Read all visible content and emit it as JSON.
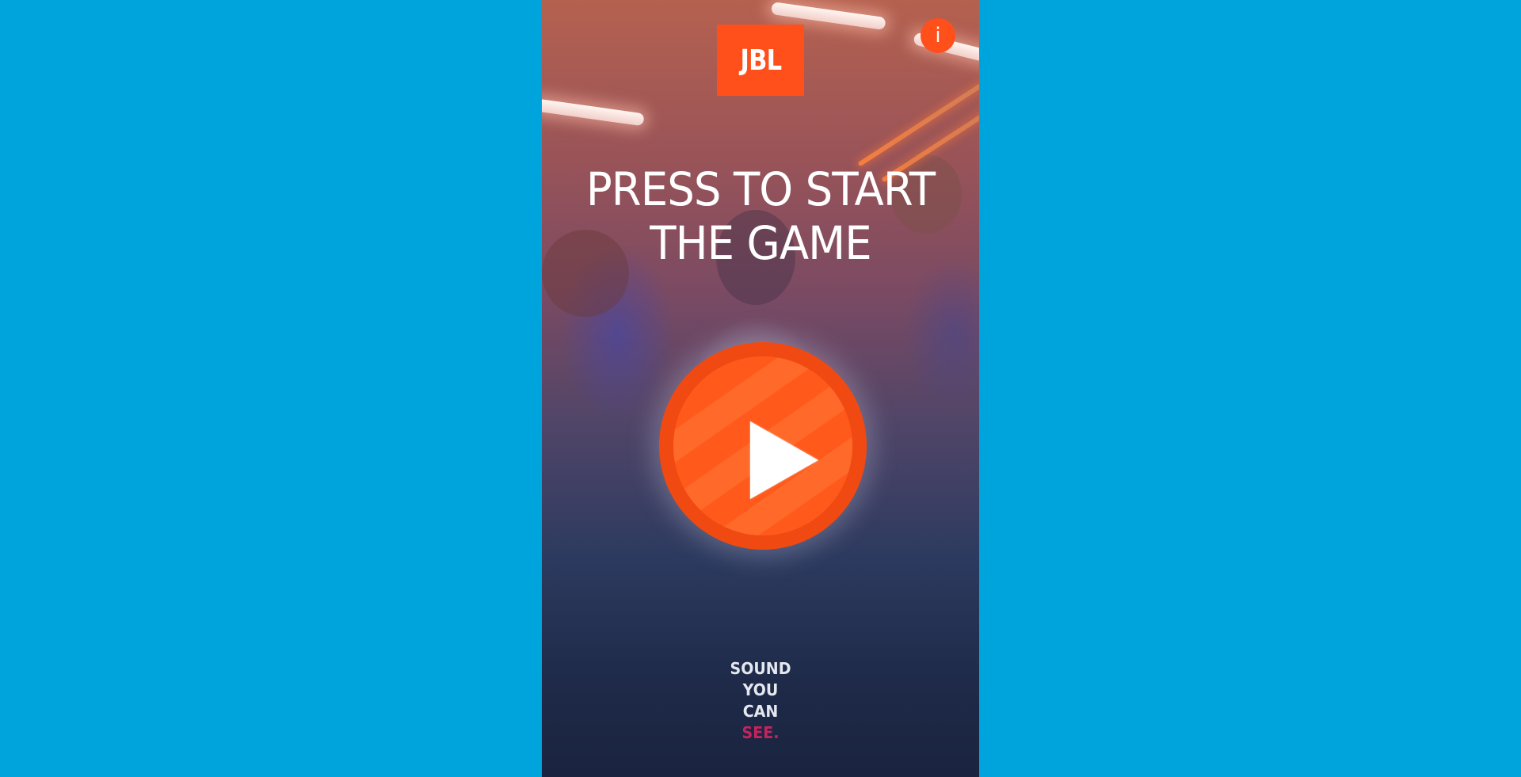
{
  "brand": {
    "logo_text": "JBL"
  },
  "info_button": {
    "label": "i"
  },
  "title": {
    "line1": "PRESS TO START",
    "line2": "THE GAME"
  },
  "tagline": {
    "line1": "SOUND",
    "line2": "YOU",
    "line3": "CAN",
    "line4": "SEE."
  },
  "colors": {
    "page_background": "#00a4dc",
    "brand_orange": "#ff4f1a",
    "tagline_accent": "#c4245e"
  },
  "icons": {
    "play": "play-icon",
    "info": "info-icon"
  }
}
